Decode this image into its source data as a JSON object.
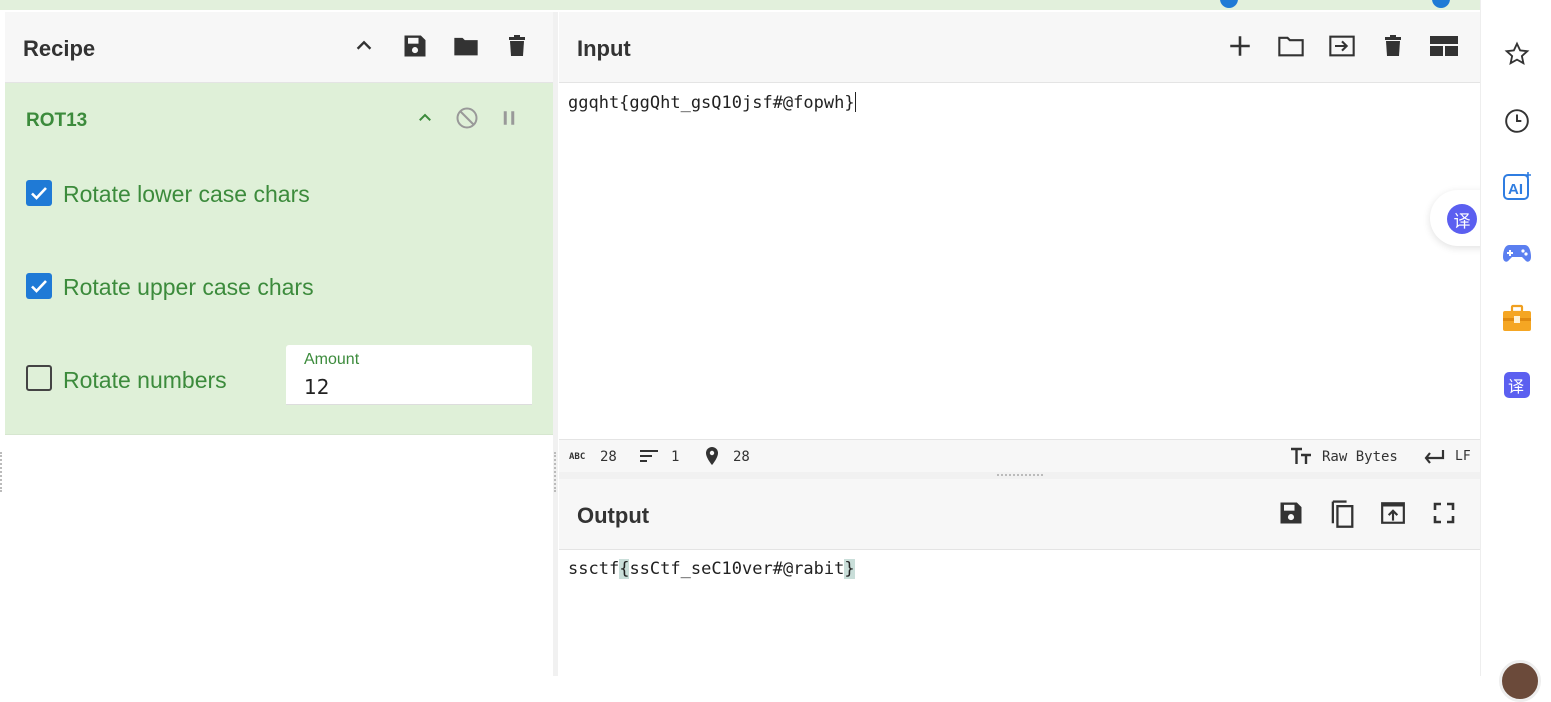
{
  "recipe": {
    "title": "Recipe",
    "operation": {
      "name": "ROT13",
      "options": [
        {
          "label": "Rotate lower case chars",
          "checked": true
        },
        {
          "label": "Rotate upper case chars",
          "checked": true
        },
        {
          "label": "Rotate numbers",
          "checked": false
        }
      ],
      "amount_label": "Amount",
      "amount_value": "12"
    }
  },
  "input": {
    "title": "Input",
    "text": "ggqht{ggQht_gsQ10jsf#@fopwh}",
    "status": {
      "chars_icon": "ABC",
      "chars": "28",
      "lines": "1",
      "position": "28",
      "encoding": "Raw Bytes",
      "eol": "LF"
    }
  },
  "output": {
    "title": "Output",
    "text_prefix": "ssctf",
    "brace_open": "{",
    "text_middle": "ssCtf_seC10ver#@rabit",
    "brace_close": "}"
  },
  "sidebar_icons": [
    "star-icon",
    "history-icon",
    "ai-icon",
    "gamepad-icon",
    "toolbox-icon",
    "translate-icon"
  ],
  "floating_translate": "译",
  "colors": {
    "accent_green": "#3c8b3c",
    "op_background": "#dff0d8",
    "checkbox_blue": "#1f7ad6"
  }
}
